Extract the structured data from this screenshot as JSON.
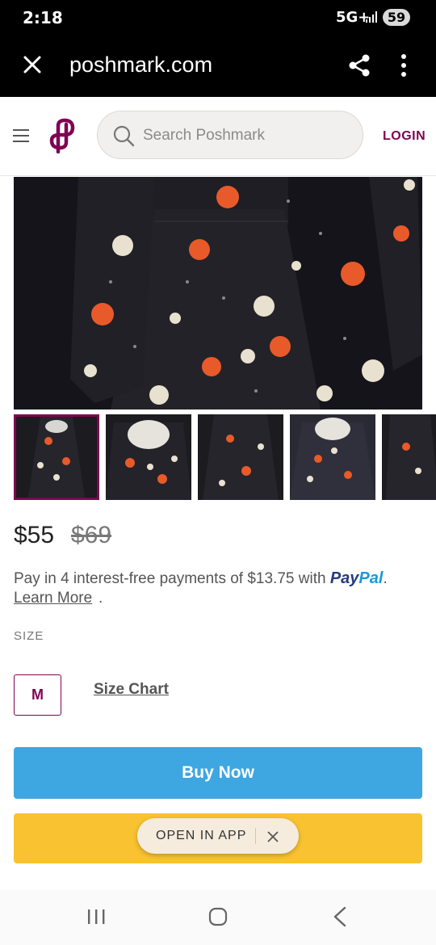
{
  "status": {
    "time": "2:18",
    "network": "5G+",
    "battery": "59"
  },
  "browser": {
    "url": "poshmark.com"
  },
  "header": {
    "search_placeholder": "Search Poshmark",
    "login_label": "LOGIN"
  },
  "listing": {
    "price": "$55",
    "original_price": "$69",
    "installment_text": "Pay in 4 interest-free payments of $13.75 with ",
    "paypal_part1": "Pay",
    "paypal_part2": "Pal",
    "installment_end": ".",
    "learn_more": "Learn More ",
    "learn_more_dot": ".",
    "size_heading": "SIZE",
    "size_value": "M",
    "size_chart_label": "Size Chart",
    "buy_now_label": "Buy Now"
  },
  "open_in_app": {
    "label": "OPEN IN APP"
  },
  "colors": {
    "brand": "#7f0353",
    "buy_button": "#3ea6e0",
    "offer_button": "#f9c230"
  },
  "icons": [
    "close-icon",
    "share-icon",
    "more-vert-icon",
    "hamburger-icon",
    "poshmark-logo",
    "search-icon",
    "recent-apps-icon",
    "home-icon",
    "back-icon"
  ]
}
